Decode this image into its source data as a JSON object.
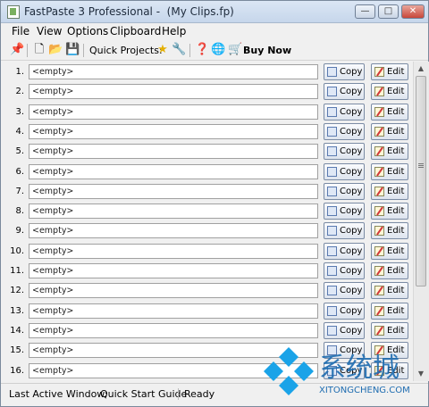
{
  "window": {
    "title": "FastPaste 3 Professional -  (My Clips.fp)",
    "minimize_glyph": "—",
    "maximize_glyph": "□",
    "close_glyph": "✕"
  },
  "menu": [
    "File",
    "View",
    "Options",
    "Clipboard",
    "Help"
  ],
  "toolbar": {
    "quick_projects_label": "Quick Projects:",
    "buy_now_label": "Buy Now"
  },
  "clips": [
    {
      "num": "1.",
      "value": "<empty>"
    },
    {
      "num": "2.",
      "value": "<empty>"
    },
    {
      "num": "3.",
      "value": "<empty>"
    },
    {
      "num": "4.",
      "value": "<empty>"
    },
    {
      "num": "5.",
      "value": "<empty>"
    },
    {
      "num": "6.",
      "value": "<empty>"
    },
    {
      "num": "7.",
      "value": "<empty>"
    },
    {
      "num": "8.",
      "value": "<empty>"
    },
    {
      "num": "9.",
      "value": "<empty>"
    },
    {
      "num": "10.",
      "value": "<empty>"
    },
    {
      "num": "11.",
      "value": "<empty>"
    },
    {
      "num": "12.",
      "value": "<empty>"
    },
    {
      "num": "13.",
      "value": "<empty>"
    },
    {
      "num": "14.",
      "value": "<empty>"
    },
    {
      "num": "15.",
      "value": "<empty>"
    },
    {
      "num": "16.",
      "value": "<empty>"
    }
  ],
  "buttons": {
    "copy_label": "Copy",
    "edit_label": "Edit"
  },
  "status": {
    "last_window_label": "Last Active Window:",
    "last_window_value": "Quick Start Guide",
    "state": "Ready"
  },
  "watermark": {
    "brand": "系统城",
    "site": "XITONGCHENG.COM"
  },
  "colors": {
    "accent": "#c6d6eb",
    "close": "#c8473a",
    "watermark_blue": "#1aa3e8"
  }
}
